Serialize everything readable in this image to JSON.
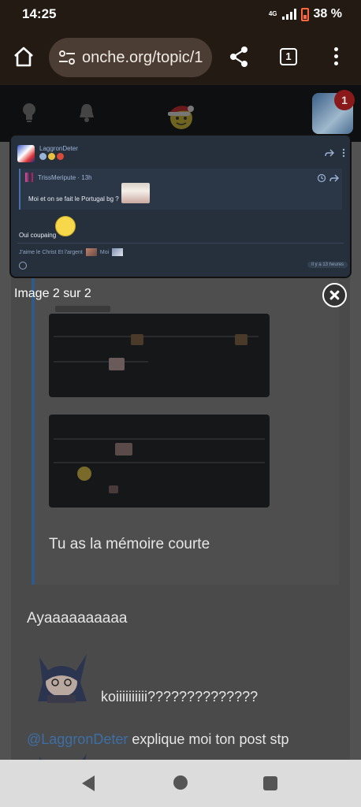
{
  "status_bar": {
    "time": "14:25",
    "network": "4G",
    "battery": "38 %"
  },
  "browser": {
    "url": "onche.org/topic/1",
    "tab_count": "1"
  },
  "lightbox": {
    "author": "LaggronDeter",
    "quote_author": "TrissMeripute · 13h",
    "quote_text": "Moi et on se fait le Portugal bg ?",
    "body_text": "Oui coupaing",
    "signature_left": "J'aime le Christ Et l'argent",
    "signature_right": "Moi",
    "time_badge": "Il y a 13 heures",
    "caption": "Image 2 sur 2"
  },
  "thread": {
    "quote_footer": "Tu as la mémoire courte",
    "reply1": "Ayaaaaaaaaaa",
    "reply2": "koiiiiiiiiii??????????????",
    "reply3_mention": "@LaggronDeter",
    "reply3_text": " explique moi ton post stp"
  }
}
